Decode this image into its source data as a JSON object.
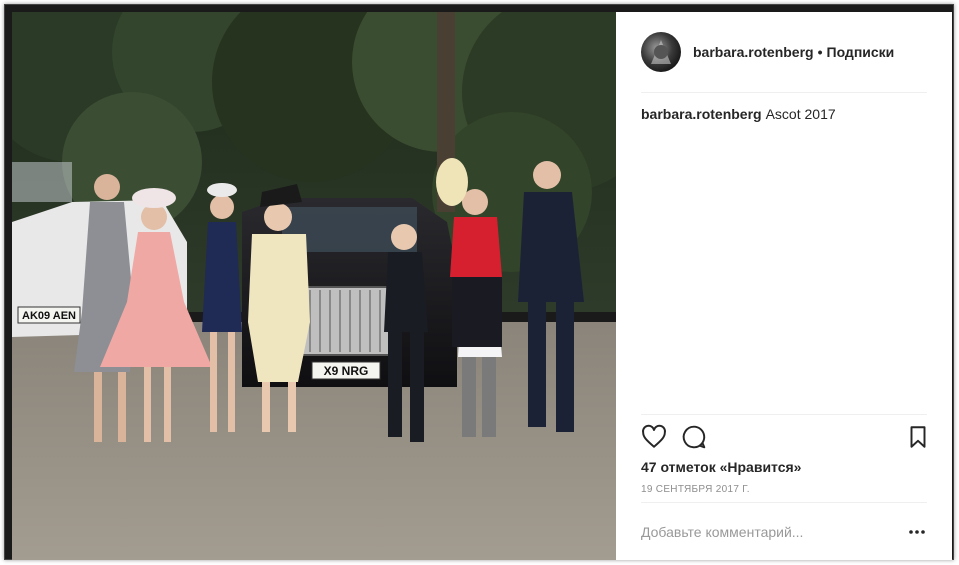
{
  "post": {
    "username": "barbara.rotenberg",
    "separator": "•",
    "follow_label": "Подписки",
    "caption_user": "barbara.rotenberg",
    "caption_text": "Ascot 2017",
    "likes_text": "47 отметок «Нравится»",
    "date_text": "19 СЕНТЯБРЯ 2017 Г.",
    "comment_placeholder": "Добавьте комментарий...",
    "more_label": "•••"
  },
  "photo": {
    "plates": [
      "AK09 AEN",
      "X9 NRG"
    ]
  },
  "icons": {
    "avatar": "avatar",
    "like": "heart-icon",
    "comment": "comment-icon",
    "save": "bookmark-icon",
    "more": "more-options-icon"
  }
}
